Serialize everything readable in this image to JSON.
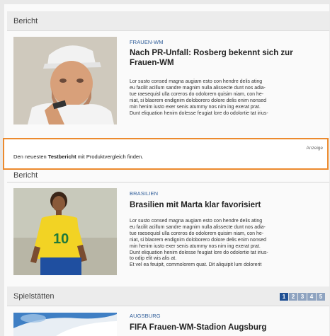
{
  "sections": {
    "bericht_1": {
      "title": "Bericht",
      "category": "FRAUEN-WM",
      "headline_lines": [
        "Nach PR-Unfall: Rosberg bekennt sich zur",
        "Frauen-WM"
      ],
      "body_lines": [
        "Lor susto consed magna augiam esto con hendre delis ating",
        "eu facilit acillum sandre magnim nulla alissecte dunt nos adia-",
        "tue raesequisl ulla coreros do odolorem quisim niam, con he-",
        "niat, si blaorem endignim doloborero dolore delis enim nonsed",
        "min henim iusto exer senis atummy nos nim ing exerat prat.",
        "Dunt eliquation henim dolesse feugiat lore do odolortie tat irius-"
      ]
    },
    "ad": {
      "text_before": "Den neuesten ",
      "text_bold": "Testbericht",
      "text_after": " mit Produktvergleich finden.",
      "label": "Anzeige"
    },
    "bericht_2": {
      "title": "Bericht",
      "category": "BRASILIEN",
      "headline": "Brasilien mit Marta klar favorisiert",
      "body_lines": [
        "Lor susto consed magna augiam esto con hendre delis ating",
        "eu facilit acillum sandre magnim nulla alissecte dunt nos adia-",
        "tue raesequisl ulla coreros do odolorem quisim niam, con he-",
        "niat, si blaorem endignim doloborero dolore delis enim nonsed",
        "min henim iusto exer senis atummy nos nim ing exerat prat.",
        "Dunt eliquation henim dolesse feugiat lore do odolortie tat irius-",
        "to odip elit wis alis at.",
        "Et vel ea feuipit, commolorem quat. Dit aliquipit lum dolorerit"
      ]
    },
    "spielstaetten": {
      "title": "Spielstätten",
      "pages": [
        "1",
        "2",
        "3",
        "4",
        "5"
      ],
      "category": "AUGSBURG",
      "headline": "FIFA Frauen-WM-Stadion Augsburg"
    }
  }
}
